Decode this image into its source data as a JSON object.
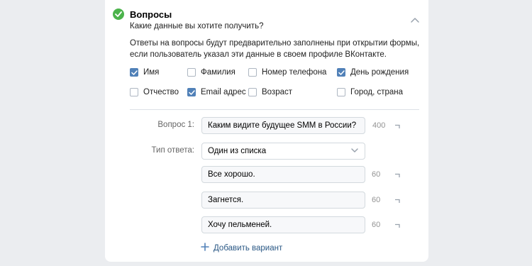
{
  "section": {
    "title": "Вопросы",
    "subtitle": "Какие данные вы хотите получить?",
    "description": "Ответы на вопросы будут предварительно заполнены при открытии формы, если пользователь указал эти данные в своем профиле ВКонтакте."
  },
  "checkboxes": [
    {
      "label": "Имя",
      "checked": true
    },
    {
      "label": "Фамилия",
      "checked": false
    },
    {
      "label": "Номер телефона",
      "checked": false
    },
    {
      "label": "День рождения",
      "checked": true
    },
    {
      "label": "Отчество",
      "checked": false
    },
    {
      "label": "Email адрес",
      "checked": true
    },
    {
      "label": "Возраст",
      "checked": false
    },
    {
      "label": "Город, страна",
      "checked": false
    }
  ],
  "question": {
    "label": "Вопрос 1:",
    "value": "Каким видите будущее SMM в России?",
    "counter": "400"
  },
  "answer_type": {
    "label": "Тип ответа:",
    "value": "Один из списка"
  },
  "options": [
    {
      "value": "Все хорошо.",
      "counter": "60"
    },
    {
      "value": "Загнется.",
      "counter": "60"
    },
    {
      "value": "Хочу пельменей.",
      "counter": "60"
    }
  ],
  "add_variant": "Добавить вариант",
  "colors": {
    "accent": "#5181b8",
    "success": "#4bb34b",
    "link": "#2a5885"
  }
}
